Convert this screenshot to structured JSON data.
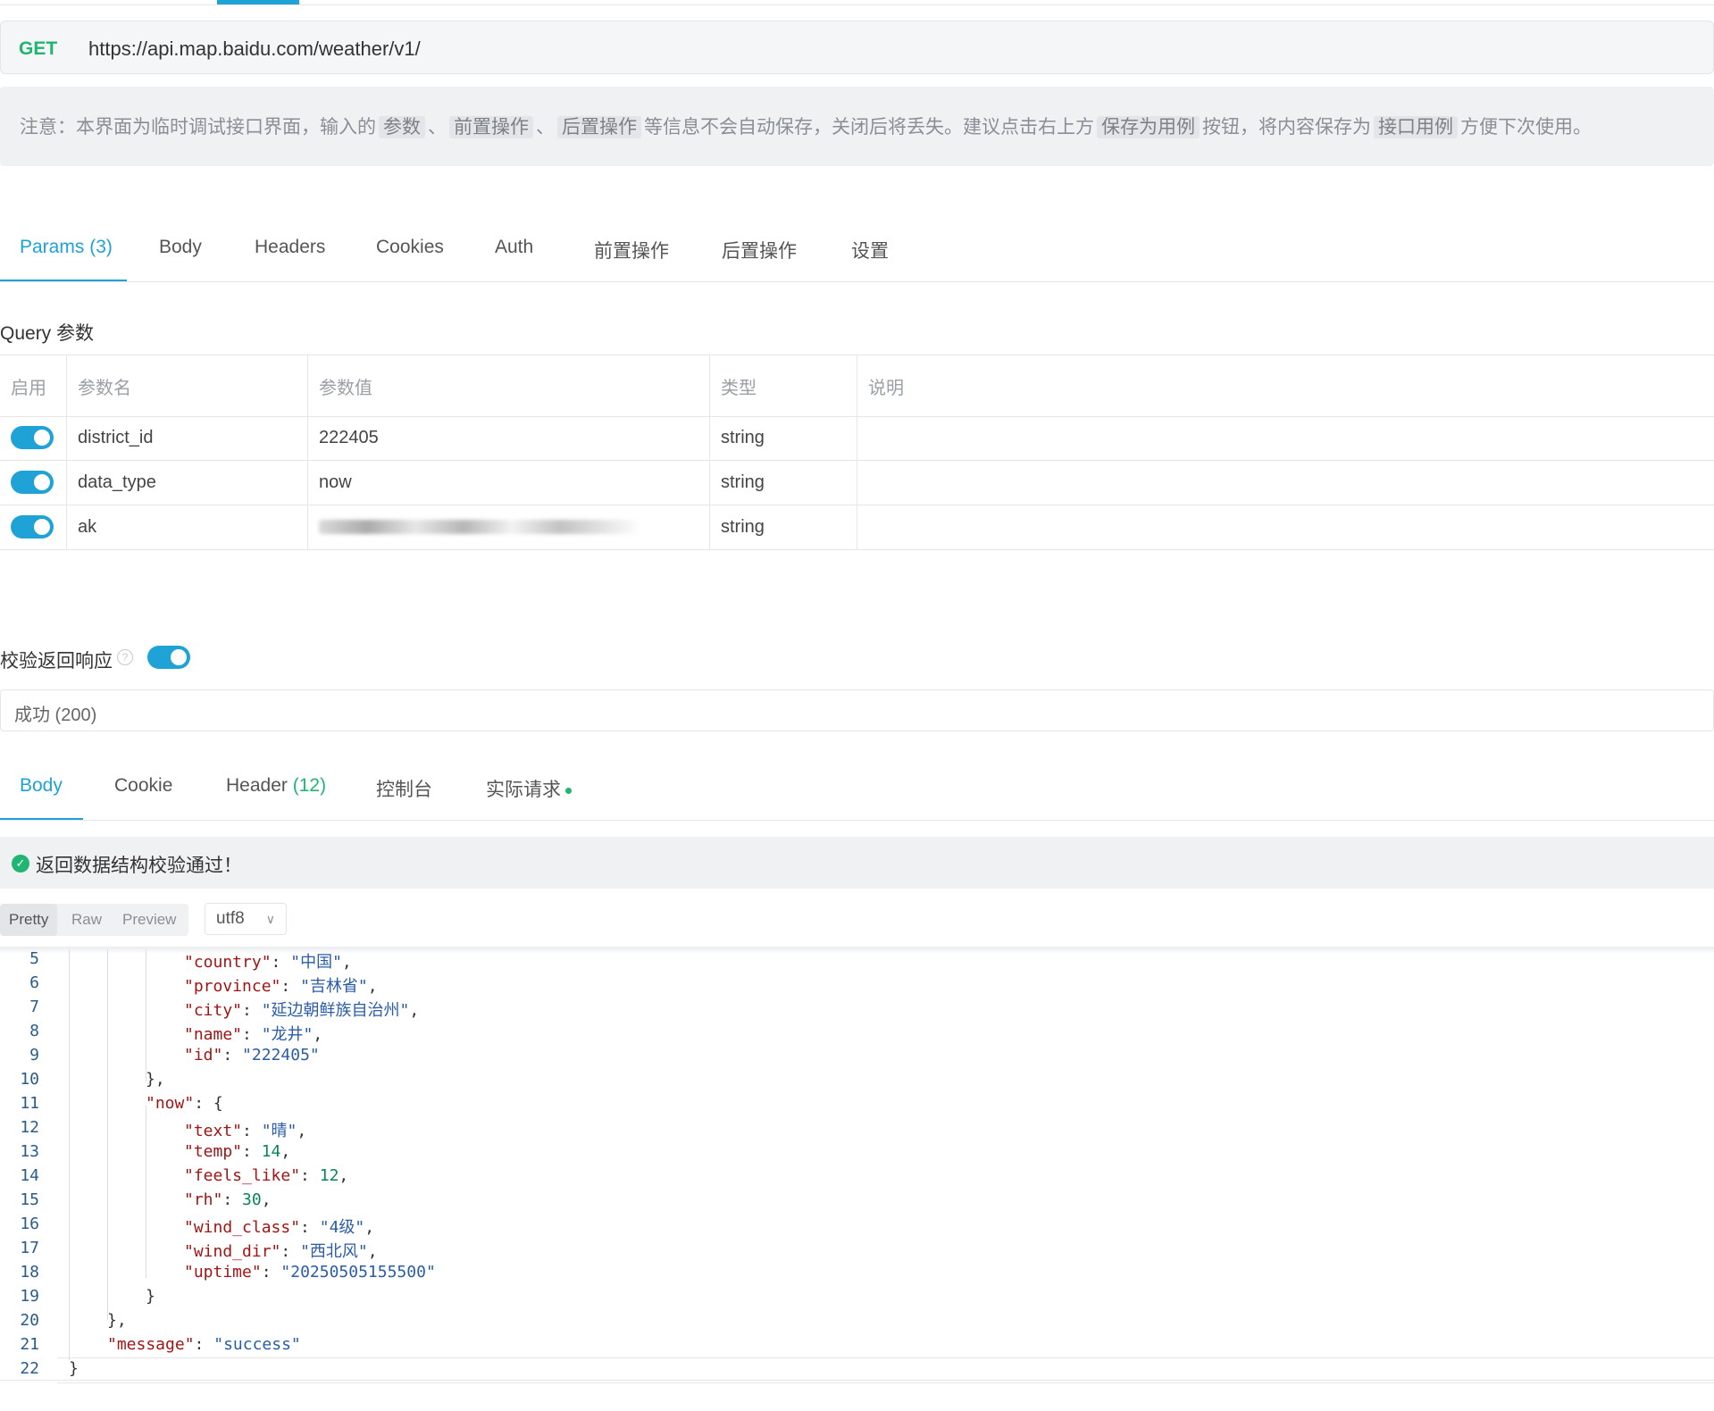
{
  "request": {
    "method": "GET",
    "url": "https://api.map.baidu.com/weather/v1/"
  },
  "notice": {
    "prefix": "注意：本界面为临时调试接口界面，输入的",
    "chip1": "参数",
    "sep1": "、",
    "chip2": "前置操作",
    "sep2": "、",
    "chip3": "后置操作",
    "mid": "等信息不会自动保存，关闭后将丢失。建议点击右上方",
    "chip4": "保存为用例",
    "mid2": "按钮，将内容保存为",
    "chip5": "接口用例",
    "suffix": "方便下次使用。"
  },
  "request_tabs": [
    {
      "label": "Params",
      "count": "(3)"
    },
    {
      "label": "Body"
    },
    {
      "label": "Headers"
    },
    {
      "label": "Cookies"
    },
    {
      "label": "Auth"
    },
    {
      "label": "前置操作"
    },
    {
      "label": "后置操作"
    },
    {
      "label": "设置"
    }
  ],
  "query": {
    "title": "Query 参数",
    "headers": [
      "启用",
      "参数名",
      "参数值",
      "类型",
      "说明"
    ],
    "rows": [
      {
        "enabled": true,
        "name": "district_id",
        "value": "222405",
        "type": "string",
        "desc": ""
      },
      {
        "enabled": true,
        "name": "data_type",
        "value": "now",
        "type": "string",
        "desc": ""
      },
      {
        "enabled": true,
        "name": "ak",
        "value": "",
        "type": "string",
        "desc": ""
      }
    ]
  },
  "validate": {
    "label": "校验返回响应",
    "help": "?",
    "enabled": true,
    "status": "成功 (200)"
  },
  "response_tabs": [
    {
      "label": "Body"
    },
    {
      "label": "Cookie"
    },
    {
      "label": "Header",
      "count": "(12)"
    },
    {
      "label": "控制台"
    },
    {
      "label": "实际请求"
    }
  ],
  "pass_message": "返回数据结构校验通过！",
  "view_modes": [
    "Pretty",
    "Raw",
    "Preview"
  ],
  "charset": "utf8",
  "code_lines": [
    {
      "n": "5"
    },
    {
      "n": "6"
    },
    {
      "n": "7"
    },
    {
      "n": "8"
    },
    {
      "n": "9"
    },
    {
      "n": "10"
    },
    {
      "n": "11"
    },
    {
      "n": "12"
    },
    {
      "n": "13"
    },
    {
      "n": "14"
    },
    {
      "n": "15"
    },
    {
      "n": "16"
    },
    {
      "n": "17"
    },
    {
      "n": "18"
    },
    {
      "n": "19"
    },
    {
      "n": "20"
    },
    {
      "n": "21"
    },
    {
      "n": "22"
    }
  ],
  "code": {
    "l5k": "\"country\"",
    "l5v": "\"中国\"",
    "l6k": "\"province\"",
    "l6v": "\"吉林省\"",
    "l7k": "\"city\"",
    "l7v": "\"延边朝鲜族自治州\"",
    "l8k": "\"name\"",
    "l8v": "\"龙井\"",
    "l9k": "\"id\"",
    "l9v": "\"222405\"",
    "l10": "},",
    "l11k": "\"now\"",
    "l11v": "{",
    "l12k": "\"text\"",
    "l12v": "\"晴\"",
    "l13k": "\"temp\"",
    "l13v": "14",
    "l14k": "\"feels_like\"",
    "l14v": "12",
    "l15k": "\"rh\"",
    "l15v": "30",
    "l16k": "\"wind_class\"",
    "l16v": "\"4级\"",
    "l17k": "\"wind_dir\"",
    "l17v": "\"西北风\"",
    "l18k": "\"uptime\"",
    "l18v": "\"20250505155500\"",
    "l19": "}",
    "l20": "},",
    "l21k": "\"message\"",
    "l21v": "\"success\"",
    "l22": "}"
  },
  "colors": {
    "accent": "#1fa2d6",
    "success": "#21b573"
  }
}
